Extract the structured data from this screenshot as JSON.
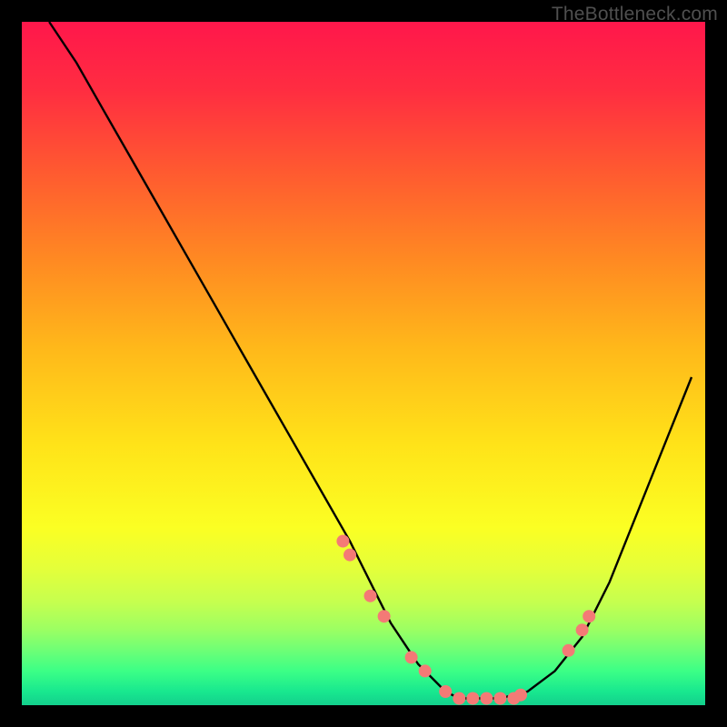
{
  "watermark": "TheBottleneck.com",
  "colors": {
    "frame": "#000000",
    "curve": "#000000",
    "dot": "#f47a76"
  },
  "chart_data": {
    "type": "line",
    "title": "",
    "xlabel": "",
    "ylabel": "",
    "xlim": [
      0,
      100
    ],
    "ylim": [
      0,
      100
    ],
    "series": [
      {
        "name": "bottleneck-curve",
        "x": [
          4,
          8,
          12,
          16,
          20,
          24,
          28,
          32,
          36,
          40,
          44,
          48,
          50,
          52,
          54,
          56,
          58,
          60,
          62,
          64,
          66,
          70,
          74,
          78,
          82,
          86,
          90,
          94,
          98
        ],
        "y": [
          100,
          94,
          87,
          80,
          73,
          66,
          59,
          52,
          45,
          38,
          31,
          24,
          20,
          16,
          12,
          9,
          6,
          4,
          2,
          1,
          1,
          1,
          2,
          5,
          10,
          18,
          28,
          38,
          48
        ]
      }
    ],
    "markers": {
      "name": "highlight-dots",
      "x": [
        47,
        48,
        51,
        53,
        57,
        59,
        62,
        64,
        66,
        68,
        70,
        72,
        73,
        80,
        82,
        83
      ],
      "y": [
        24,
        22,
        16,
        13,
        7,
        5,
        2,
        1,
        1,
        1,
        1,
        1,
        1.5,
        8,
        11,
        13
      ]
    }
  }
}
